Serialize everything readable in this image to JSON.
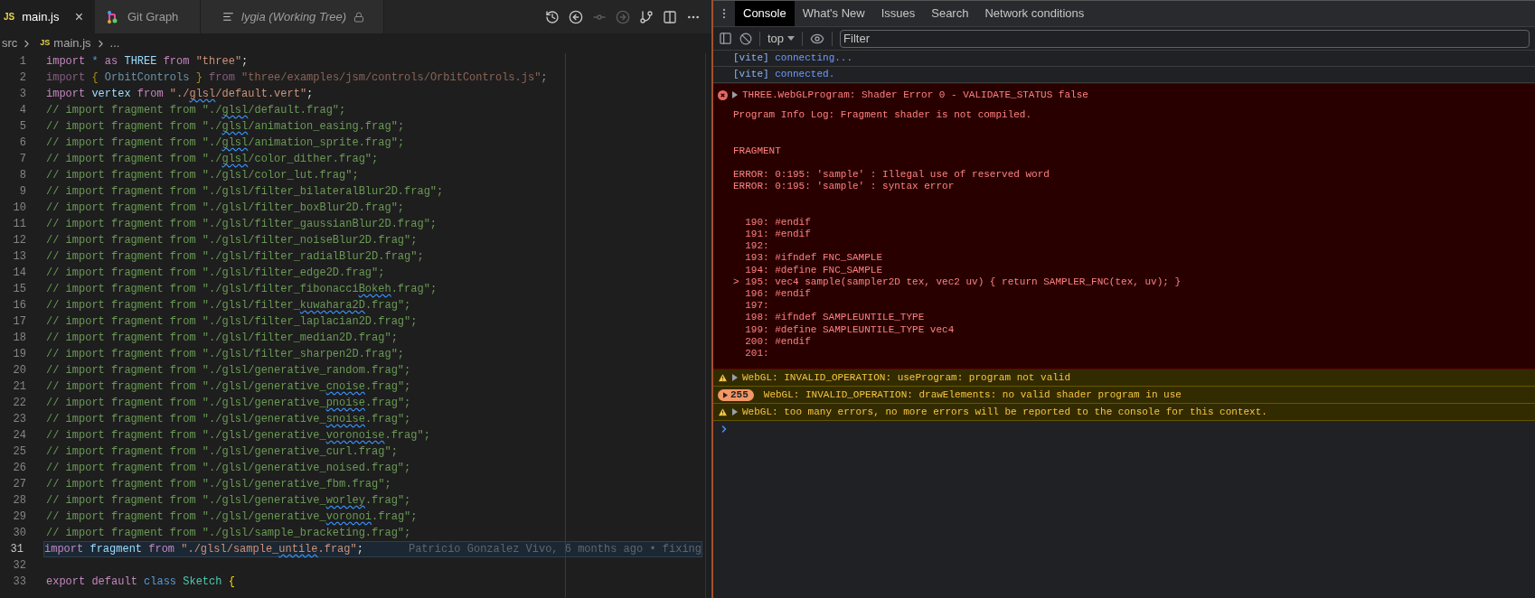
{
  "editor": {
    "tabs": [
      {
        "kind": "js",
        "icon_text": "JS",
        "label": "main.js",
        "selected": true,
        "italic": false,
        "close": "×"
      },
      {
        "kind": "git-graph",
        "label": "Git Graph",
        "selected": false,
        "italic": false
      },
      {
        "kind": "working-tree",
        "label": "lygia (Working Tree)",
        "selected": false,
        "italic": true,
        "locked": true
      }
    ],
    "toolbar": [
      {
        "kind": "history",
        "disabled": false
      },
      {
        "kind": "back",
        "disabled": false
      },
      {
        "kind": "commit",
        "disabled": true
      },
      {
        "kind": "forward",
        "disabled": true
      },
      {
        "kind": "branch",
        "disabled": false
      },
      {
        "kind": "split",
        "disabled": false
      },
      {
        "kind": "more",
        "disabled": false
      }
    ],
    "breadcrumb": [
      {
        "label": "src"
      },
      {
        "icon_text": "JS",
        "label": "main.js"
      },
      {
        "label": "..."
      }
    ],
    "lines": [
      {
        "number": "1",
        "current": false,
        "faded": false,
        "tokens": [
          {
            "kind": "keyword",
            "text": "import "
          },
          {
            "kind": "operator",
            "text": "* "
          },
          {
            "kind": "keyword",
            "text": "as "
          },
          {
            "kind": "variable",
            "text": "THREE "
          },
          {
            "kind": "keyword",
            "text": "from "
          },
          {
            "kind": "string",
            "text": "\"three\""
          },
          {
            "kind": "punct",
            "text": ";"
          }
        ]
      },
      {
        "number": "2",
        "current": false,
        "faded": true,
        "tokens": [
          {
            "kind": "keyword",
            "text": "import "
          },
          {
            "kind": "brace",
            "text": "{"
          },
          {
            "kind": "variable",
            "text": " OrbitControls "
          },
          {
            "kind": "brace",
            "text": "}"
          },
          {
            "kind": "keyword",
            "text": " from "
          },
          {
            "kind": "string",
            "text": "\"three/examples/jsm/controls/OrbitControls.js\""
          },
          {
            "kind": "punct",
            "text": ";"
          }
        ]
      },
      {
        "number": "3",
        "current": false,
        "faded": false,
        "tokens": [
          {
            "kind": "keyword",
            "text": "import "
          },
          {
            "kind": "variable",
            "text": "vertex "
          },
          {
            "kind": "keyword",
            "text": "from "
          },
          {
            "kind": "string",
            "text": "\"./"
          },
          {
            "kind": "string",
            "text": "glsl",
            "squiggle": true
          },
          {
            "kind": "string",
            "text": "/default.vert\""
          },
          {
            "kind": "punct",
            "text": ";"
          }
        ]
      },
      {
        "number": "4",
        "current": false,
        "faded": false,
        "tokens": [
          {
            "kind": "comment",
            "text": "// import fragment from \"./"
          },
          {
            "kind": "comment",
            "text": "glsl",
            "squiggle": true
          },
          {
            "kind": "comment",
            "text": "/default.frag\";"
          }
        ]
      },
      {
        "number": "5",
        "current": false,
        "faded": false,
        "tokens": [
          {
            "kind": "comment",
            "text": "// import fragment from \"./"
          },
          {
            "kind": "comment",
            "text": "glsl",
            "squiggle": true
          },
          {
            "kind": "comment",
            "text": "/animation_easing.frag\";"
          }
        ]
      },
      {
        "number": "6",
        "current": false,
        "faded": false,
        "tokens": [
          {
            "kind": "comment",
            "text": "// import fragment from \"./"
          },
          {
            "kind": "comment",
            "text": "glsl",
            "squiggle": true
          },
          {
            "kind": "comment",
            "text": "/animation_sprite.frag\";"
          }
        ]
      },
      {
        "number": "7",
        "current": false,
        "faded": false,
        "tokens": [
          {
            "kind": "comment",
            "text": "// import fragment from \"./"
          },
          {
            "kind": "comment",
            "text": "glsl",
            "squiggle": true
          },
          {
            "kind": "comment",
            "text": "/color_dither.frag\";"
          }
        ]
      },
      {
        "number": "8",
        "current": false,
        "faded": false,
        "tokens": [
          {
            "kind": "comment",
            "text": "// import fragment from \"./glsl/color_lut.frag\";"
          }
        ]
      },
      {
        "number": "9",
        "current": false,
        "faded": false,
        "tokens": [
          {
            "kind": "comment",
            "text": "// import fragment from \"./glsl/filter_bilateralBlur2D.frag\";"
          }
        ]
      },
      {
        "number": "10",
        "current": false,
        "faded": false,
        "tokens": [
          {
            "kind": "comment",
            "text": "// import fragment from \"./glsl/filter_boxBlur2D.frag\";"
          }
        ]
      },
      {
        "number": "11",
        "current": false,
        "faded": false,
        "tokens": [
          {
            "kind": "comment",
            "text": "// import fragment from \"./glsl/filter_gaussianBlur2D.frag\";"
          }
        ]
      },
      {
        "number": "12",
        "current": false,
        "faded": false,
        "tokens": [
          {
            "kind": "comment",
            "text": "// import fragment from \"./glsl/filter_noiseBlur2D.frag\";"
          }
        ]
      },
      {
        "number": "13",
        "current": false,
        "faded": false,
        "tokens": [
          {
            "kind": "comment",
            "text": "// import fragment from \"./glsl/filter_radialBlur2D.frag\";"
          }
        ]
      },
      {
        "number": "14",
        "current": false,
        "faded": false,
        "tokens": [
          {
            "kind": "comment",
            "text": "// import fragment from \"./glsl/filter_edge2D.frag\";"
          }
        ]
      },
      {
        "number": "15",
        "current": false,
        "faded": false,
        "tokens": [
          {
            "kind": "comment",
            "text": "// import fragment from \"./glsl/filter_fibonacci"
          },
          {
            "kind": "comment",
            "text": "Bokeh",
            "squiggle": true
          },
          {
            "kind": "comment",
            "text": ".frag\";"
          }
        ]
      },
      {
        "number": "16",
        "current": false,
        "faded": false,
        "tokens": [
          {
            "kind": "comment",
            "text": "// import fragment from \"./glsl/filter_"
          },
          {
            "kind": "comment",
            "text": "kuwahara2D",
            "squiggle": true
          },
          {
            "kind": "comment",
            "text": ".frag\";"
          }
        ]
      },
      {
        "number": "17",
        "current": false,
        "faded": false,
        "tokens": [
          {
            "kind": "comment",
            "text": "// import fragment from \"./glsl/filter_laplacian2D.frag\";"
          }
        ]
      },
      {
        "number": "18",
        "current": false,
        "faded": false,
        "tokens": [
          {
            "kind": "comment",
            "text": "// import fragment from \"./glsl/filter_median2D.frag\";"
          }
        ]
      },
      {
        "number": "19",
        "current": false,
        "faded": false,
        "tokens": [
          {
            "kind": "comment",
            "text": "// import fragment from \"./glsl/filter_sharpen2D.frag\";"
          }
        ]
      },
      {
        "number": "20",
        "current": false,
        "faded": false,
        "tokens": [
          {
            "kind": "comment",
            "text": "// import fragment from \"./glsl/generative_random.frag\";"
          }
        ]
      },
      {
        "number": "21",
        "current": false,
        "faded": false,
        "tokens": [
          {
            "kind": "comment",
            "text": "// import fragment from \"./glsl/generative_"
          },
          {
            "kind": "comment",
            "text": "cnoise",
            "squiggle": true
          },
          {
            "kind": "comment",
            "text": ".frag\";"
          }
        ]
      },
      {
        "number": "22",
        "current": false,
        "faded": false,
        "tokens": [
          {
            "kind": "comment",
            "text": "// import fragment from \"./glsl/generative_"
          },
          {
            "kind": "comment",
            "text": "pnoise",
            "squiggle": true
          },
          {
            "kind": "comment",
            "text": ".frag\";"
          }
        ]
      },
      {
        "number": "23",
        "current": false,
        "faded": false,
        "tokens": [
          {
            "kind": "comment",
            "text": "// import fragment from \"./glsl/generative_"
          },
          {
            "kind": "comment",
            "text": "snoise",
            "squiggle": true
          },
          {
            "kind": "comment",
            "text": ".frag\";"
          }
        ]
      },
      {
        "number": "24",
        "current": false,
        "faded": false,
        "tokens": [
          {
            "kind": "comment",
            "text": "// import fragment from \"./glsl/generative_"
          },
          {
            "kind": "comment",
            "text": "voronoise",
            "squiggle": true
          },
          {
            "kind": "comment",
            "text": ".frag\";"
          }
        ]
      },
      {
        "number": "25",
        "current": false,
        "faded": false,
        "tokens": [
          {
            "kind": "comment",
            "text": "// import fragment from \"./glsl/generative_curl.frag\";"
          }
        ]
      },
      {
        "number": "26",
        "current": false,
        "faded": false,
        "tokens": [
          {
            "kind": "comment",
            "text": "// import fragment from \"./glsl/generative_noised.frag\";"
          }
        ]
      },
      {
        "number": "27",
        "current": false,
        "faded": false,
        "tokens": [
          {
            "kind": "comment",
            "text": "// import fragment from \"./glsl/generative_fbm.frag\";"
          }
        ]
      },
      {
        "number": "28",
        "current": false,
        "faded": false,
        "tokens": [
          {
            "kind": "comment",
            "text": "// import fragment from \"./glsl/generative_"
          },
          {
            "kind": "comment",
            "text": "worley",
            "squiggle": true
          },
          {
            "kind": "comment",
            "text": ".frag\";"
          }
        ]
      },
      {
        "number": "29",
        "current": false,
        "faded": false,
        "tokens": [
          {
            "kind": "comment",
            "text": "// import fragment from \"./glsl/generative_"
          },
          {
            "kind": "comment",
            "text": "voronoi",
            "squiggle": true
          },
          {
            "kind": "comment",
            "text": ".frag\";"
          }
        ]
      },
      {
        "number": "30",
        "current": false,
        "faded": false,
        "tokens": [
          {
            "kind": "comment",
            "text": "// import fragment from \"./glsl/sample_bracketing.frag\";"
          }
        ]
      },
      {
        "number": "31",
        "current": true,
        "faded": false,
        "tokens": [
          {
            "kind": "keyword",
            "text": "import "
          },
          {
            "kind": "variable",
            "text": "fragment "
          },
          {
            "kind": "keyword",
            "text": "from "
          },
          {
            "kind": "string",
            "text": "\"./glsl/sample_"
          },
          {
            "kind": "string",
            "text": "untile",
            "squiggle": true
          },
          {
            "kind": "string",
            "text": ".frag\""
          },
          {
            "kind": "punct",
            "text": ";"
          }
        ],
        "blame": "Patricio Gonzalez Vivo, 6 months ago • fixing"
      },
      {
        "number": "32",
        "current": false,
        "faded": false
      },
      {
        "number": "33",
        "current": false,
        "faded": false,
        "tokens": [
          {
            "kind": "keyword",
            "text": "export "
          },
          {
            "kind": "keyword",
            "text": "default "
          },
          {
            "kind": "storage",
            "text": "class "
          },
          {
            "kind": "type",
            "text": "Sketch "
          },
          {
            "kind": "brace",
            "text": "{"
          }
        ]
      }
    ]
  },
  "devtools": {
    "tabs": [
      {
        "label": "Console",
        "selected": true
      },
      {
        "label": "What's New",
        "selected": false
      },
      {
        "label": "Issues",
        "selected": false
      },
      {
        "label": "Search",
        "selected": false
      },
      {
        "label": "Network conditions",
        "selected": false
      }
    ],
    "context": "top",
    "filter": {
      "placeholder": "Filter"
    },
    "messages": [
      {
        "kind": "info",
        "source": "[vite]",
        "text": "connecting..."
      },
      {
        "kind": "info",
        "source": "[vite]",
        "text": "connected."
      },
      {
        "kind": "error",
        "expanded": false,
        "text": "THREE.WebGLProgram: Shader Error 0 - VALIDATE_STATUS false",
        "details": "Program Info Log: Fragment shader is not compiled.\n\n\nFRAGMENT\n\nERROR: 0:195: 'sample' : Illegal use of reserved word\nERROR: 0:195: 'sample' : syntax error\n\n\n  190: #endif\n  191: #endif\n  192:\n  193: #ifndef FNC_SAMPLE\n  194: #define FNC_SAMPLE\n> 195: vec4 sample(sampler2D tex, vec2 uv) { return SAMPLER_FNC(tex, uv); }\n  196: #endif\n  197:\n  198: #ifndef SAMPLEUNTILE_TYPE\n  199: #define SAMPLEUNTILE_TYPE vec4\n  200: #endif\n  201:"
      },
      {
        "kind": "warning",
        "expanded": false,
        "text": "WebGL: INVALID_OPERATION: useProgram: program not valid"
      },
      {
        "kind": "warning",
        "expanded": false,
        "count": "255",
        "text": "WebGL: INVALID_OPERATION: drawElements: no valid shader program in use"
      },
      {
        "kind": "warning",
        "expanded": false,
        "text": "WebGL: too many errors, no more errors will be reported to the console for this context."
      }
    ]
  }
}
